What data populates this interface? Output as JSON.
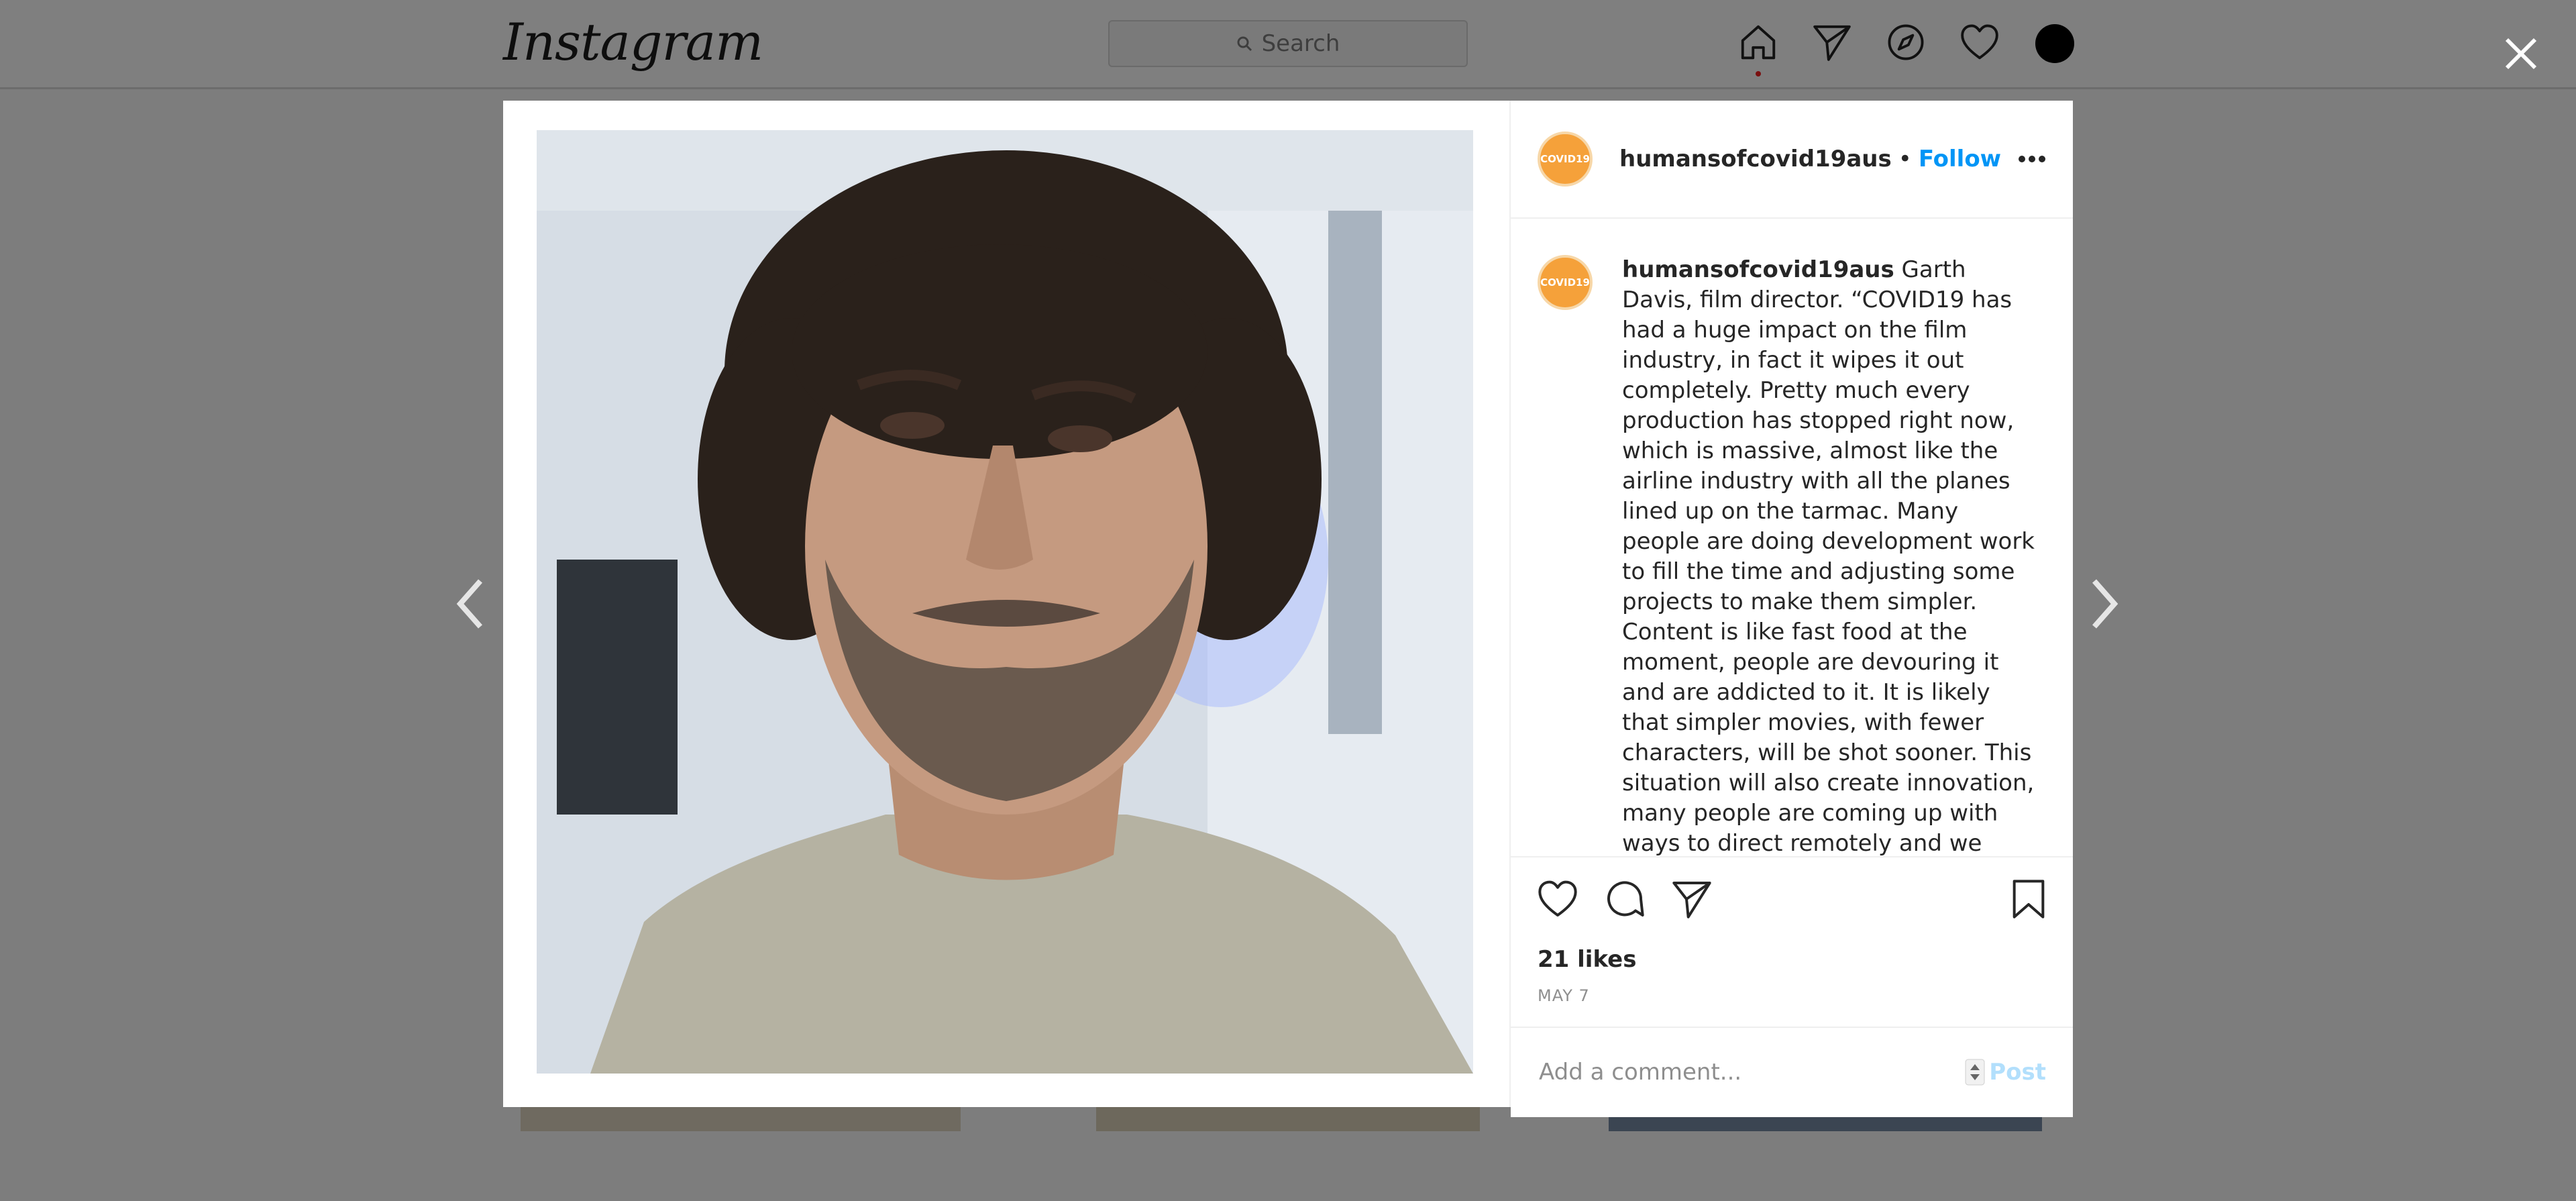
{
  "app": {
    "logo_text": "Instagram"
  },
  "search": {
    "placeholder": "Search"
  },
  "nav": {
    "icons": [
      "home-icon",
      "direct-icon",
      "explore-icon",
      "activity-icon",
      "profile-avatar"
    ]
  },
  "post": {
    "username": "humansofcovid19aus",
    "separator": "•",
    "follow_label": "Follow",
    "badge_text": "COVID19",
    "caption_author": "humansofcovid19aus",
    "caption_text": " Garth Davis, film director. “COVID19 has had a huge impact on the film industry, in fact it wipes it out completely. Pretty much every production has stopped right now, which is massive, almost like the airline industry with all the planes lined up on the tarmac. Many people are doing development work to fill the time and adjusting some projects to make them simpler.\nContent is like fast food at the moment, people are devouring it and are addicted to it. It is likely that simpler movies, with fewer characters, will be shot sooner. This situation will also create innovation, many people are coming up with ways to direct remotely and we could see a lot more animation and visual effects",
    "likes": "21 likes",
    "date": "MAY 7",
    "comment_placeholder": "Add a comment...",
    "post_label": "Post"
  },
  "colors": {
    "accent": "#0095f6",
    "badge": "#f5a13a",
    "overlay": "#7d7d7d"
  }
}
